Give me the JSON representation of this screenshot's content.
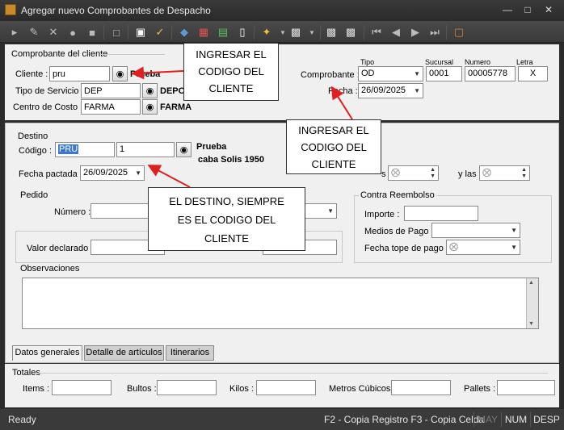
{
  "window": {
    "title": "Agregar nuevo Comprobantes de Despacho"
  },
  "toolbar": {
    "icons": [
      "navigate-icon",
      "edit-icon",
      "delete-icon",
      "search-icon",
      "lock-icon",
      "copy-icon",
      "save-icon",
      "approve-icon",
      "tag-icon",
      "calendar-icon",
      "grid-icon",
      "barcode-icon",
      "tools-icon",
      "print-icon",
      "print-preview-icon",
      "print-icon-2",
      "first-icon",
      "prev-icon",
      "next-icon",
      "last-icon",
      "exit-icon"
    ]
  },
  "cliente_group": {
    "title": "Comprobante del cliente",
    "cliente_label": "Cliente :",
    "cliente_value": "pru",
    "cliente_name": "Prueba",
    "tipo_servicio_label": "Tipo de Servicio :",
    "tipo_servicio_value": "DEP",
    "tipo_servicio_name": "DEPO",
    "centro_costo_label": "Centro de Costo :",
    "centro_costo_value": "FARMA",
    "centro_costo_name": "FARMA",
    "comprobante_label": "Comprobante :",
    "tipo_header": "Tipo",
    "sucursal_header": "Sucursal",
    "numero_header": "Numero",
    "letra_header": "Letra",
    "tipo_value": "OD",
    "sucursal_value": "0001",
    "numero_value": "00005778",
    "letra_value": "X",
    "fecha_label": "Fecha :",
    "fecha_value": "26/09/2025"
  },
  "destino_group": {
    "title": "Destino",
    "codigo_label": "Código :",
    "codigo_value": "PRU",
    "codigo_num": "1",
    "dest_name": "Prueba",
    "dest_address": "caba  Solis 1950",
    "fecha_pactada_label": "Fecha pactada :",
    "fecha_pactada_value": "26/09/2025",
    "horario_label_partial": "s",
    "y_las_label": "y las"
  },
  "pedido_group": {
    "title": "Pedido",
    "numero_label": "Número :"
  },
  "valor_label": "Valor declarado :",
  "reembolso_group": {
    "title": "Contra Reembolso",
    "importe_label": "Importe :",
    "medios_pago_label": "Medios de Pago :",
    "fecha_tope_label": "Fecha tope de pago :"
  },
  "observaciones": {
    "title": "Observaciones"
  },
  "tabs": [
    {
      "label": "Datos generales"
    },
    {
      "label": "Detalle de artículos"
    },
    {
      "label": "Itinerarios"
    }
  ],
  "totales": {
    "title": "Totales",
    "items_label": "Items :",
    "bultos_label": "Bultos :",
    "kilos_label": "Kilos :",
    "metros_label": "Metros Cúbicos :",
    "pallets_label": "Pallets :"
  },
  "callouts": {
    "c1": [
      "INGRESAR EL",
      "CODIGO DEL",
      "CLIENTE"
    ],
    "c2": [
      "INGRESAR EL",
      "CODIGO DEL",
      "CLIENTE"
    ],
    "c3": [
      "EL DESTINO, SIEMPRE",
      "ES EL CODIGO DEL",
      "CLIENTE"
    ]
  },
  "status": {
    "ready": "Ready",
    "hint": "F2 - Copia Registro F3 - Copia Celda",
    "may": "MAY",
    "num": "NUM",
    "desp": "DESP"
  },
  "colors": {
    "arrow": "#e02020",
    "selection": "#3a78d8"
  }
}
